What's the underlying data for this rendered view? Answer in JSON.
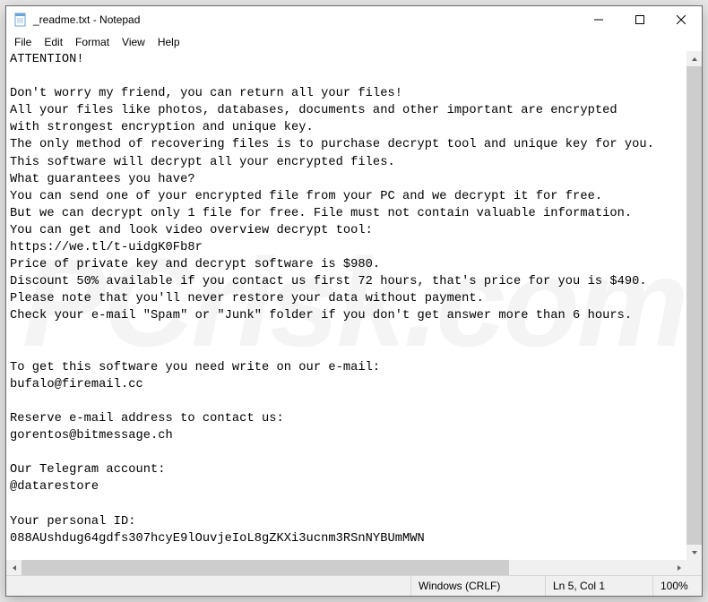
{
  "window": {
    "title": "_readme.txt - Notepad"
  },
  "menu": {
    "file": "File",
    "edit": "Edit",
    "format": "Format",
    "view": "View",
    "help": "Help"
  },
  "document": {
    "text": "ATTENTION!\n\nDon't worry my friend, you can return all your files!\nAll your files like photos, databases, documents and other important are encrypted\nwith strongest encryption and unique key.\nThe only method of recovering files is to purchase decrypt tool and unique key for you.\nThis software will decrypt all your encrypted files.\nWhat guarantees you have?\nYou can send one of your encrypted file from your PC and we decrypt it for free.\nBut we can decrypt only 1 file for free. File must not contain valuable information.\nYou can get and look video overview decrypt tool:\nhttps://we.tl/t-uidgK0Fb8r\nPrice of private key and decrypt software is $980.\nDiscount 50% available if you contact us first 72 hours, that's price for you is $490.\nPlease note that you'll never restore your data without payment.\nCheck your e-mail \"Spam\" or \"Junk\" folder if you don't get answer more than 6 hours.\n\n\nTo get this software you need write on our e-mail:\nbufalo@firemail.cc\n\nReserve e-mail address to contact us:\ngorentos@bitmessage.ch\n\nOur Telegram account:\n@datarestore\n\nYour personal ID:\n088AUshdug64gdfs307hcyE9lOuvjeIoL8gZKXi3ucnm3RSnNYBUmMWN"
  },
  "status": {
    "line_ending": "Windows (CRLF)",
    "cursor": "Ln 5, Col 1",
    "zoom": "100%"
  },
  "watermark": "PCrisk.com"
}
